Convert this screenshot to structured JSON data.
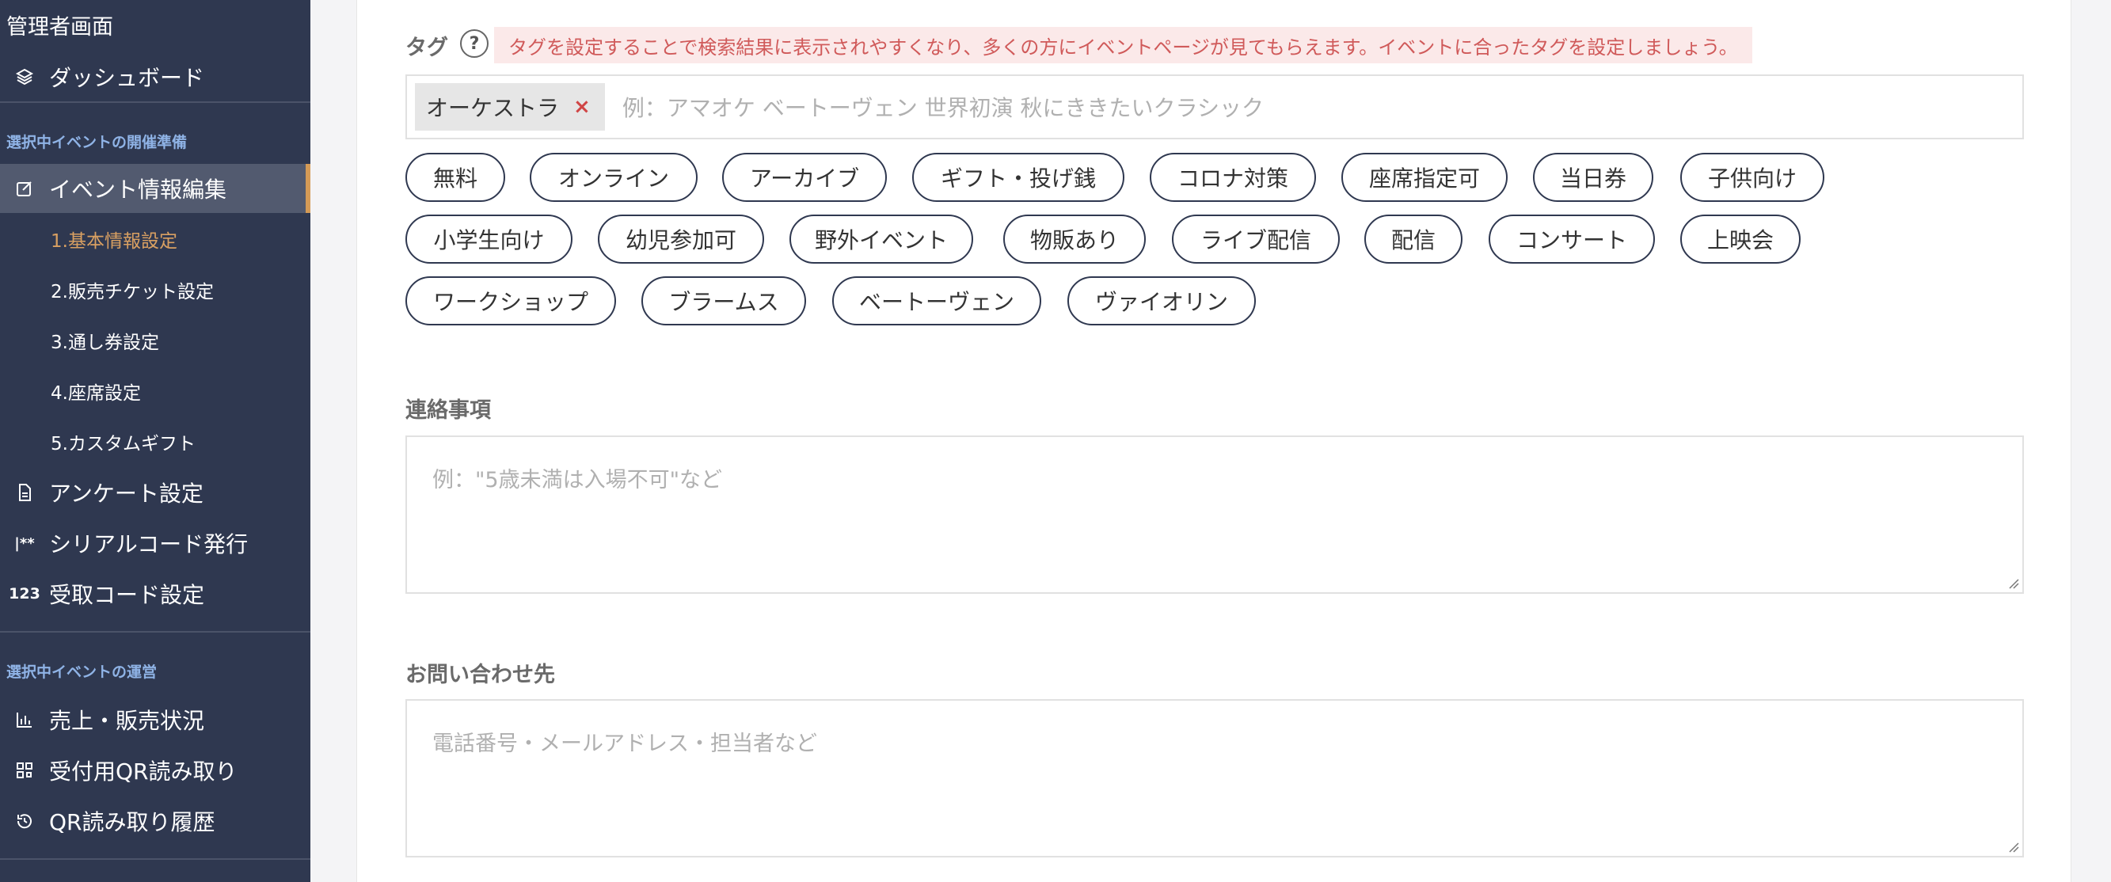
{
  "sidebar": {
    "title": "管理者画面",
    "dashboard": "ダッシュボード",
    "section_prepare": "選択中イベントの開催準備",
    "event_edit": "イベント情報編集",
    "sub_items": [
      "1.基本情報設定",
      "2.販売チケット設定",
      "3.通し券設定",
      "4.座席設定",
      "5.カスタムギフト"
    ],
    "survey": "アンケート設定",
    "serial_icon": "|**",
    "serial": "シリアルコード発行",
    "receive_code_icon": "123",
    "receive_code": "受取コード設定",
    "section_operate": "選択中イベントの運営",
    "sales": "売上・販売状況",
    "qr_read": "受付用QR読み取り",
    "qr_history": "QR読み取り履歴"
  },
  "tags": {
    "label": "タグ",
    "help": "?",
    "hint": "タグを設定することで検索結果に表示されやすくなり、多くの方にイベントページが見てもらえます。イベントに合ったタグを設定しましょう。",
    "selected": [
      "オーケストラ"
    ],
    "remove_symbol": "×",
    "placeholder": "例：アマオケ ベートーヴェン 世界初演 秋にききたいクラシック",
    "suggestions": [
      "無料",
      "オンライン",
      "アーカイブ",
      "ギフト・投げ銭",
      "コロナ対策",
      "座席指定可",
      "当日券",
      "子供向け",
      "小学生向け",
      "幼児参加可",
      "野外イベント",
      "物販あり",
      "ライブ配信",
      "配信",
      "コンサート",
      "上映会",
      "ワークショップ",
      "ブラームス",
      "ベートーヴェン",
      "ヴァイオリン"
    ]
  },
  "notes": {
    "label": "連絡事項",
    "placeholder": "例：\"5歳未満は入場不可\"など"
  },
  "contact": {
    "label": "お問い合わせ先",
    "placeholder": "電話番号・メールアドレス・担当者など"
  }
}
